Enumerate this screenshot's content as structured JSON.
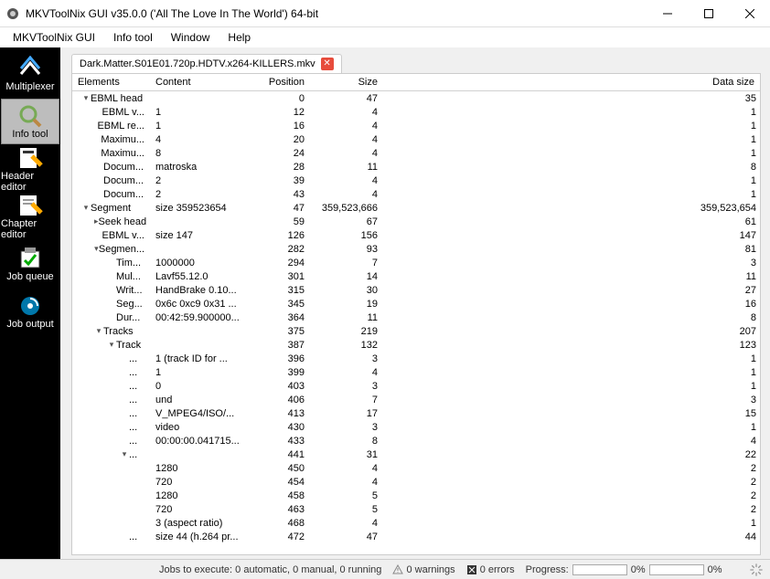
{
  "window": {
    "title": "MKVToolNix GUI v35.0.0 ('All The Love In The World') 64-bit"
  },
  "menu": [
    "MKVToolNix GUI",
    "Info tool",
    "Window",
    "Help"
  ],
  "sidebar": [
    {
      "label": "Multiplexer",
      "icon": "multiplexer"
    },
    {
      "label": "Info tool",
      "icon": "info",
      "selected": true
    },
    {
      "label": "Header editor",
      "icon": "header"
    },
    {
      "label": "Chapter editor",
      "icon": "chapter"
    },
    {
      "label": "Job queue",
      "icon": "queue"
    },
    {
      "label": "Job output",
      "icon": "output"
    }
  ],
  "tab": {
    "name": "Dark.Matter.S01E01.720p.HDTV.x264-KILLERS.mkv"
  },
  "columns": {
    "elements": "Elements",
    "content": "Content",
    "position": "Position",
    "size": "Size",
    "data_size": "Data size"
  },
  "rows": [
    {
      "indent": 0,
      "toggle": "open",
      "el": "EBML head",
      "ct": "",
      "pos": "0",
      "size": "47",
      "ds": "35"
    },
    {
      "indent": 1,
      "el": "EBML v...",
      "ct": "1",
      "pos": "12",
      "size": "4",
      "ds": "1"
    },
    {
      "indent": 1,
      "el": "EBML re...",
      "ct": "1",
      "pos": "16",
      "size": "4",
      "ds": "1"
    },
    {
      "indent": 1,
      "el": "Maximu...",
      "ct": "4",
      "pos": "20",
      "size": "4",
      "ds": "1"
    },
    {
      "indent": 1,
      "el": "Maximu...",
      "ct": "8",
      "pos": "24",
      "size": "4",
      "ds": "1"
    },
    {
      "indent": 1,
      "el": "Docum...",
      "ct": "matroska",
      "pos": "28",
      "size": "11",
      "ds": "8"
    },
    {
      "indent": 1,
      "el": "Docum...",
      "ct": "2",
      "pos": "39",
      "size": "4",
      "ds": "1"
    },
    {
      "indent": 1,
      "el": "Docum...",
      "ct": "2",
      "pos": "43",
      "size": "4",
      "ds": "1"
    },
    {
      "indent": 0,
      "toggle": "open",
      "el": "Segment",
      "ct": "size 359523654",
      "pos": "47",
      "size": "359,523,666",
      "ds": "359,523,654"
    },
    {
      "indent": 1,
      "toggle": "closed",
      "el": "Seek head",
      "ct": "",
      "pos": "59",
      "size": "67",
      "ds": "61"
    },
    {
      "indent": 1,
      "el": "EBML v...",
      "ct": "size 147",
      "pos": "126",
      "size": "156",
      "ds": "147"
    },
    {
      "indent": 1,
      "toggle": "open",
      "el": "Segmen...",
      "ct": "",
      "pos": "282",
      "size": "93",
      "ds": "81"
    },
    {
      "indent": 2,
      "el": "Tim...",
      "ct": "1000000",
      "pos": "294",
      "size": "7",
      "ds": "3"
    },
    {
      "indent": 2,
      "el": "Mul...",
      "ct": "Lavf55.12.0",
      "pos": "301",
      "size": "14",
      "ds": "11"
    },
    {
      "indent": 2,
      "el": "Writ...",
      "ct": "HandBrake 0.10...",
      "pos": "315",
      "size": "30",
      "ds": "27"
    },
    {
      "indent": 2,
      "el": "Seg...",
      "ct": "0x6c 0xc9 0x31 ...",
      "pos": "345",
      "size": "19",
      "ds": "16"
    },
    {
      "indent": 2,
      "el": "Dur...",
      "ct": "00:42:59.900000...",
      "pos": "364",
      "size": "11",
      "ds": "8"
    },
    {
      "indent": 1,
      "toggle": "open",
      "el": "Tracks",
      "ct": "",
      "pos": "375",
      "size": "219",
      "ds": "207"
    },
    {
      "indent": 2,
      "toggle": "open",
      "el": "Track",
      "ct": "",
      "pos": "387",
      "size": "132",
      "ds": "123"
    },
    {
      "indent": 3,
      "el": "...",
      "ct": "1 (track ID for ...",
      "pos": "396",
      "size": "3",
      "ds": "1"
    },
    {
      "indent": 3,
      "el": "...",
      "ct": "1",
      "pos": "399",
      "size": "4",
      "ds": "1"
    },
    {
      "indent": 3,
      "el": "...",
      "ct": "0",
      "pos": "403",
      "size": "3",
      "ds": "1"
    },
    {
      "indent": 3,
      "el": "...",
      "ct": "und",
      "pos": "406",
      "size": "7",
      "ds": "3"
    },
    {
      "indent": 3,
      "el": "...",
      "ct": "V_MPEG4/ISO/...",
      "pos": "413",
      "size": "17",
      "ds": "15"
    },
    {
      "indent": 3,
      "el": "...",
      "ct": "video",
      "pos": "430",
      "size": "3",
      "ds": "1"
    },
    {
      "indent": 3,
      "el": "...",
      "ct": "00:00:00.041715...",
      "pos": "433",
      "size": "8",
      "ds": "4"
    },
    {
      "indent": 3,
      "toggle": "open",
      "el": "...",
      "ct": "",
      "pos": "441",
      "size": "31",
      "ds": "22"
    },
    {
      "indent": 4,
      "el": "",
      "ct": "1280",
      "pos": "450",
      "size": "4",
      "ds": "2"
    },
    {
      "indent": 4,
      "el": "",
      "ct": "720",
      "pos": "454",
      "size": "4",
      "ds": "2"
    },
    {
      "indent": 4,
      "el": "",
      "ct": "1280",
      "pos": "458",
      "size": "5",
      "ds": "2"
    },
    {
      "indent": 4,
      "el": "",
      "ct": "720",
      "pos": "463",
      "size": "5",
      "ds": "2"
    },
    {
      "indent": 4,
      "el": "",
      "ct": "3 (aspect ratio)",
      "pos": "468",
      "size": "4",
      "ds": "1"
    },
    {
      "indent": 3,
      "el": "...",
      "ct": "size 44 (h.264 pr...",
      "pos": "472",
      "size": "47",
      "ds": "44"
    }
  ],
  "status": {
    "jobs_label": "Jobs to execute:",
    "jobs_value": "0 automatic, 0 manual, 0 running",
    "warnings": "0 warnings",
    "errors": "0 errors",
    "progress_label": "Progress:",
    "pct": "0%"
  }
}
